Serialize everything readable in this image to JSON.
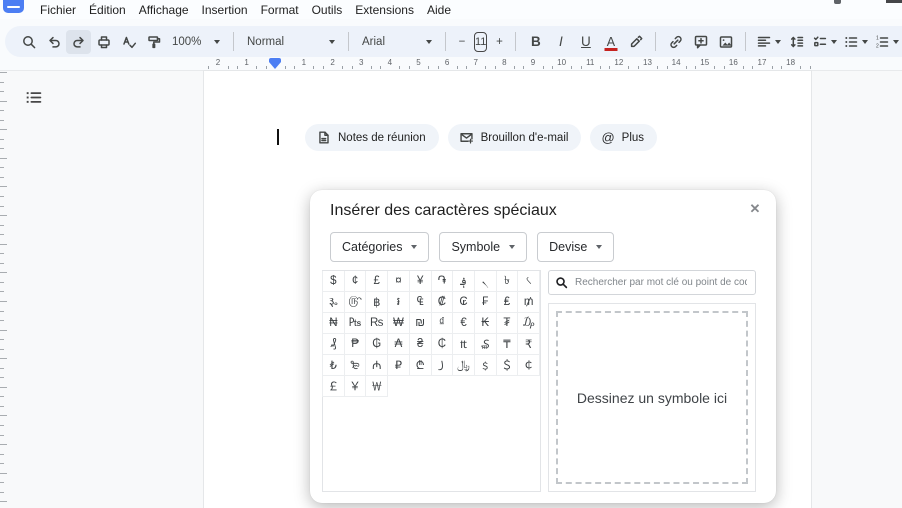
{
  "menubar": {
    "items": [
      "Fichier",
      "Édition",
      "Affichage",
      "Insertion",
      "Format",
      "Outils",
      "Extensions",
      "Aide"
    ]
  },
  "toolbar": {
    "zoom": "100%",
    "paragraph_style": "Normal",
    "font": "Arial",
    "font_size": "11",
    "decrease_font": "−",
    "increase_font": "+",
    "bold": "B",
    "italic": "I",
    "underline": "U",
    "text_color": "A"
  },
  "ruler": {
    "margin_numbers": [
      "2",
      "1"
    ],
    "numbers": [
      "1",
      "2",
      "3",
      "4",
      "5",
      "6",
      "7",
      "8",
      "9",
      "10",
      "11",
      "12",
      "13",
      "14",
      "15",
      "16",
      "17",
      "18"
    ]
  },
  "document": {
    "chips": [
      {
        "label": "Notes de réunion"
      },
      {
        "label": "Brouillon d'e-mail"
      },
      {
        "label": "Plus"
      }
    ]
  },
  "dialog": {
    "title": "Insérer des caractères spéciaux",
    "filters": [
      {
        "label": "Catégories"
      },
      {
        "label": "Symbole"
      },
      {
        "label": "Devise"
      }
    ],
    "search_placeholder": "Rechercher par mot clé ou point de code",
    "draw_hint": "Dessinez un symbole ici",
    "symbols": [
      "$",
      "¢",
      "£",
      "¤",
      "¥",
      "֏",
      "؋",
      "৲",
      "৳",
      "৻",
      "૱",
      "௹",
      "฿",
      "៛",
      "₠",
      "₡",
      "₢",
      "₣",
      "₤",
      "₥",
      "₦",
      "₧",
      "₨",
      "₩",
      "₪",
      "₫",
      "€",
      "₭",
      "₮",
      "₯",
      "₰",
      "₱",
      "₲",
      "₳",
      "₴",
      "₵",
      "₶",
      "₷",
      "₸",
      "₹",
      "₺",
      "₻",
      "₼",
      "₽",
      "₾",
      "꠸",
      "﷼",
      "﹩",
      "＄",
      "￠",
      "￡",
      "￥",
      "￦"
    ]
  },
  "icons": {
    "close": "✕",
    "at": "@"
  },
  "colors": {
    "toolbar_bg": "#edf2fa",
    "accent_blue": "#4c7ef3",
    "chip_bg": "#f0f4f9",
    "text_color_indicator": "#c5221f"
  }
}
